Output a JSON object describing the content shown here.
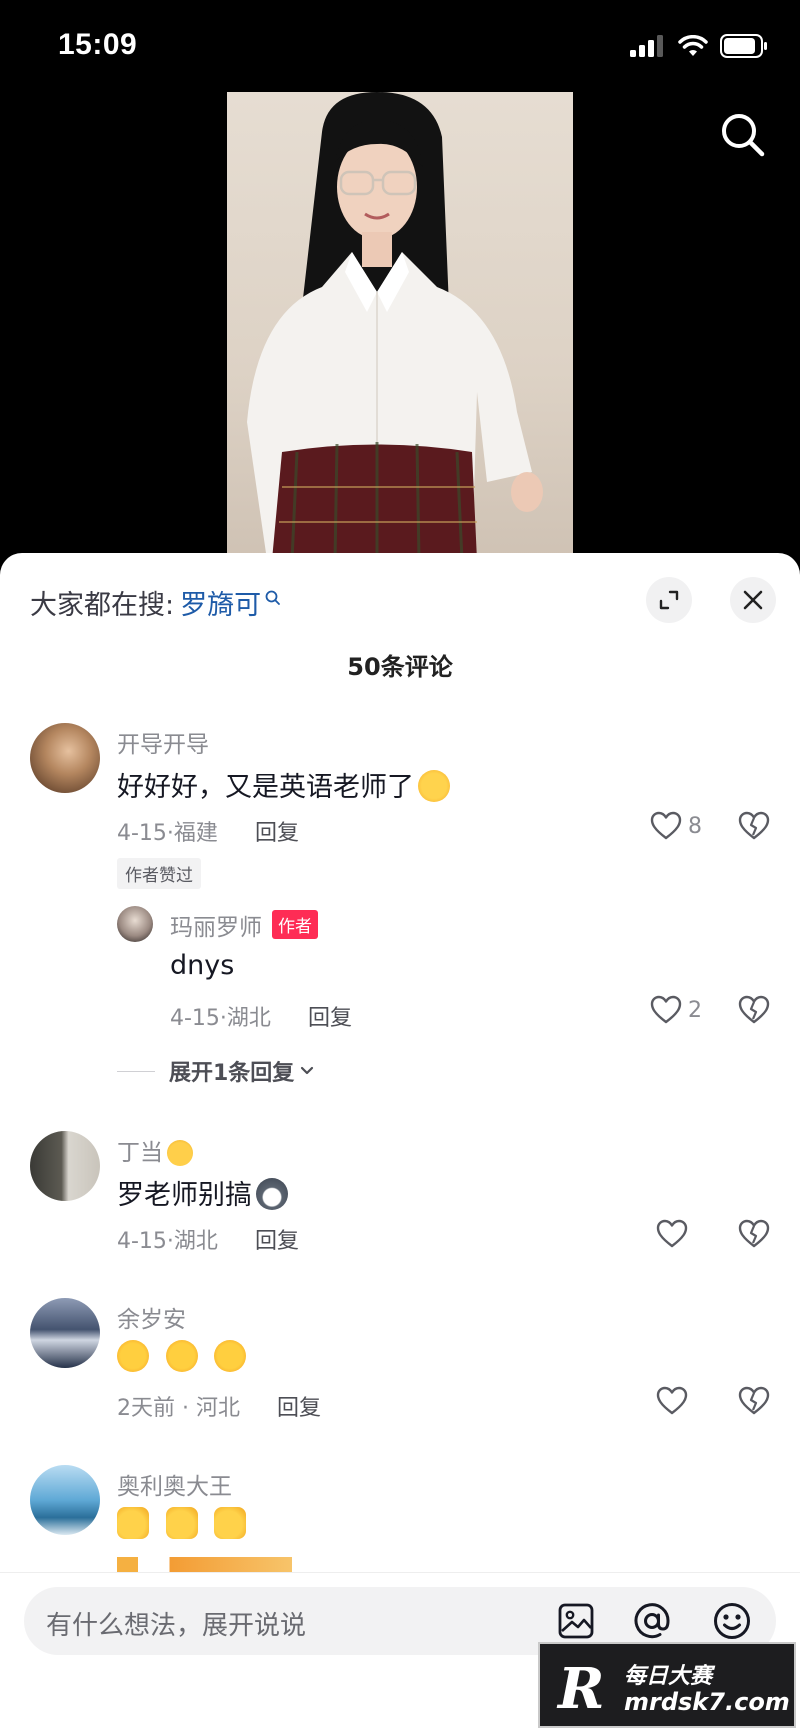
{
  "status_bar": {
    "time": "15:09"
  },
  "header": {
    "hot_search_prefix": "大家都在搜:",
    "hot_search_keyword": "罗旖可",
    "comment_count": "50条评论"
  },
  "comments": [
    {
      "user": "开导开导",
      "text": "好好好，又是英语老师了",
      "date_location": "4-15·福建",
      "reply_label": "回复",
      "likes": "8",
      "badge": "作者赞过",
      "reply": {
        "user": "玛丽罗师",
        "author_tag": "作者",
        "text": "dnys",
        "date_location": "4-15·湖北",
        "reply_label": "回复",
        "likes": "2"
      },
      "expand_label": "展开1条回复"
    },
    {
      "user": "丁当",
      "text": "罗老师别搞",
      "date_location": "4-15·湖北",
      "reply_label": "回复",
      "likes": ""
    },
    {
      "user": "余岁安",
      "text": "",
      "date_location": "2天前 · 河北",
      "reply_label": "回复",
      "likes": ""
    },
    {
      "user": "奥利奥大王",
      "text": "",
      "date_location": "",
      "reply_label": "",
      "likes": ""
    }
  ],
  "input": {
    "placeholder": "有什么想法，展开说说"
  },
  "watermark": {
    "name": "每日大赛",
    "url": "mrdsk7.com",
    "logo": "R"
  },
  "colors": {
    "accent": "#fe2c55",
    "link": "#1e5ba8",
    "muted": "#8a8b91"
  }
}
